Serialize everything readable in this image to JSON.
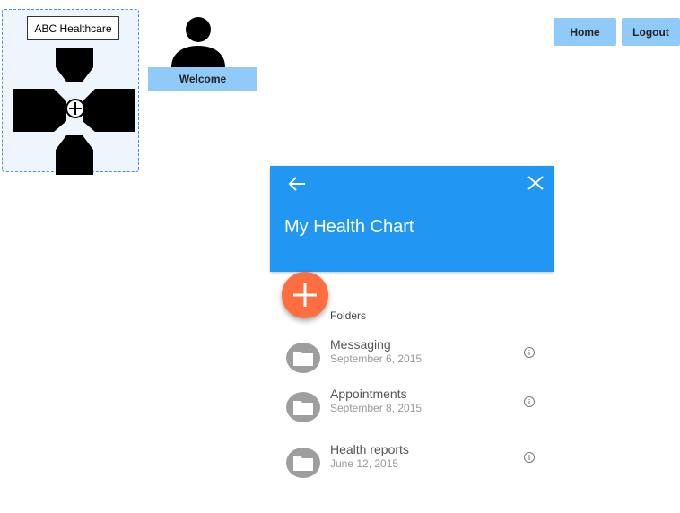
{
  "logo": {
    "title": "ABC Healthcare",
    "icon": "medical-cross-icon"
  },
  "user": {
    "avatar_icon": "user-avatar-icon",
    "welcome_label": "Welcome"
  },
  "nav": {
    "home_label": "Home",
    "logout_label": "Logout"
  },
  "panel": {
    "title": "My Health Chart",
    "back_icon": "arrow-back-icon",
    "close_icon": "close-icon",
    "header_color": "#2196f3"
  },
  "fab": {
    "icon": "plus-icon",
    "color": "#ff6e40"
  },
  "folders": {
    "heading": "Folders",
    "items": [
      {
        "name": "Messaging",
        "date": "September 6, 2015"
      },
      {
        "name": "Appointments",
        "date": "September 8, 2015"
      },
      {
        "name": "Health reports",
        "date": "June 12, 2015"
      }
    ]
  }
}
